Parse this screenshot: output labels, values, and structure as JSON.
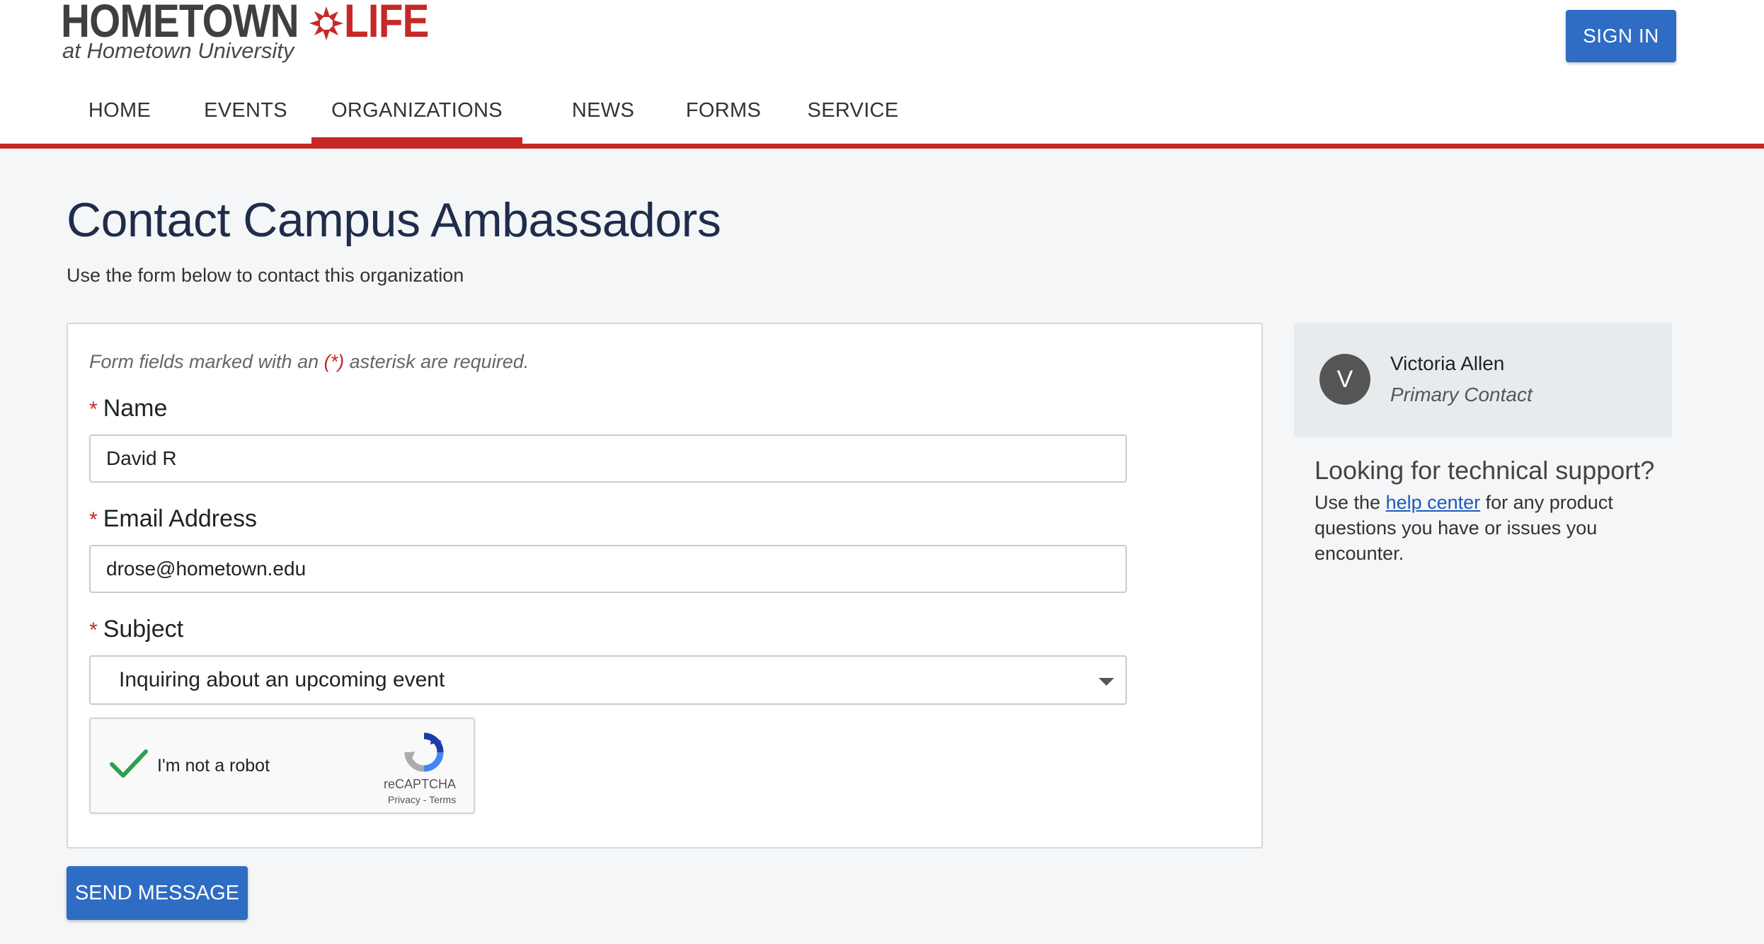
{
  "header": {
    "logo": {
      "brand_home": "HOMETOWN",
      "brand_life": "LIFE",
      "tagline": "at Hometown University"
    },
    "sign_in_label": "SIGN IN",
    "nav": [
      {
        "label": "HOME",
        "active": false
      },
      {
        "label": "EVENTS",
        "active": false
      },
      {
        "label": "ORGANIZATIONS",
        "active": true
      },
      {
        "label": "NEWS",
        "active": false
      },
      {
        "label": "FORMS",
        "active": false
      },
      {
        "label": "SERVICE",
        "active": false
      }
    ]
  },
  "page": {
    "title": "Contact Campus Ambassadors",
    "subtitle": "Use the form below to contact this organization"
  },
  "form": {
    "required_note_prefix": "Form fields marked with an ",
    "required_note_star": "(*)",
    "required_note_suffix": " asterisk are required.",
    "required_marker": "*",
    "name": {
      "label": "Name",
      "value": "David R"
    },
    "email": {
      "label": "Email Address",
      "value": "drose@hometown.edu"
    },
    "subject": {
      "label": "Subject",
      "value": "Inquiring about an upcoming event"
    },
    "captcha": {
      "label": "I'm not a robot",
      "brand": "reCAPTCHA",
      "links": "Privacy - Terms",
      "checked": true
    },
    "send_label": "SEND MESSAGE"
  },
  "sidebar": {
    "contact": {
      "initial": "V",
      "name": "Victoria Allen",
      "role": "Primary Contact"
    },
    "support": {
      "heading": "Looking for technical support?",
      "text_prefix": "Use the ",
      "link": "help center",
      "text_suffix": " for any product questions you have or issues you encounter."
    }
  },
  "colors": {
    "accent_red": "#c62828",
    "primary_blue": "#2f6cc4",
    "link_blue": "#1f5ab8",
    "captcha_check_green": "#2e9e4f"
  }
}
